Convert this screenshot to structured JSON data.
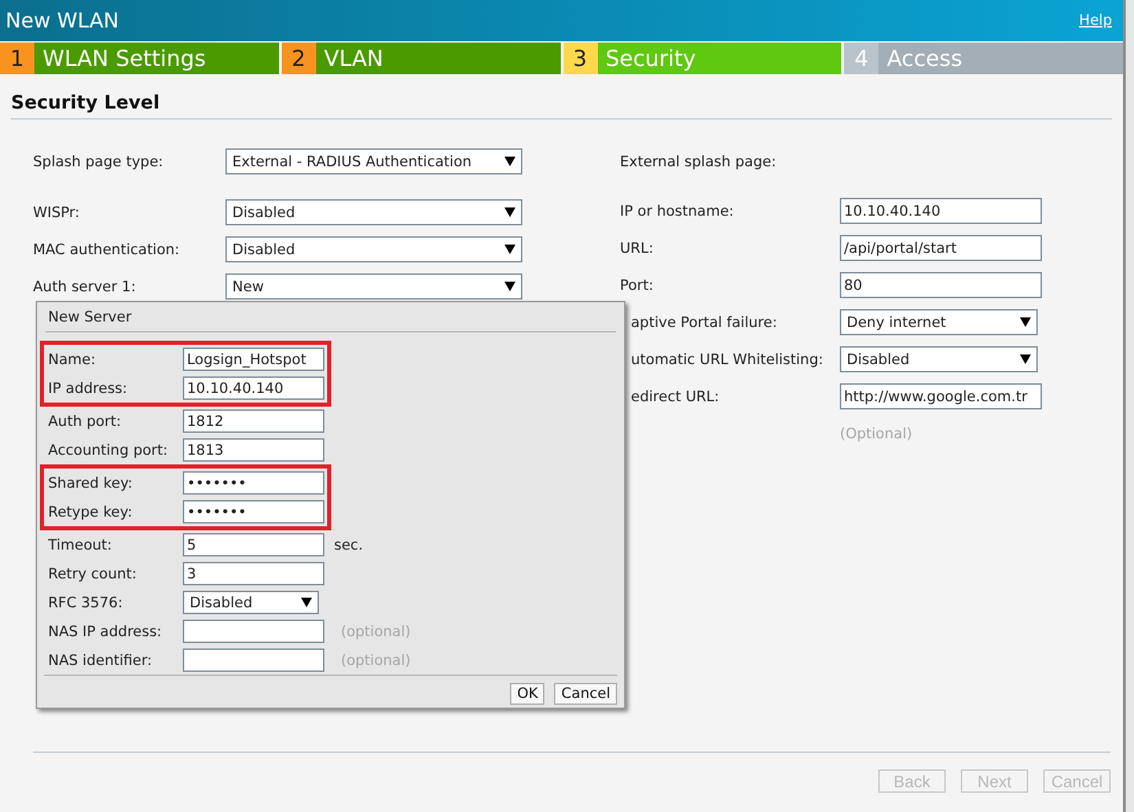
{
  "window": {
    "title": "New WLAN",
    "help_link": "Help"
  },
  "steps": [
    {
      "number": "1",
      "label": "WLAN Settings",
      "done": true,
      "selected": false
    },
    {
      "number": "2",
      "label": "VLAN",
      "done": true,
      "selected": false
    },
    {
      "number": "3",
      "label": "Security",
      "done": false,
      "selected": true
    },
    {
      "number": "4",
      "label": "Access",
      "done": false,
      "selected": false
    }
  ],
  "section_title": "Security Level",
  "left_fields": [
    {
      "label": "Splash page type:",
      "kind": "select",
      "value": "External - RADIUS Authentication"
    },
    {
      "label": "WISPr:",
      "kind": "select",
      "value": "Disabled"
    },
    {
      "label": "MAC authentication:",
      "kind": "select",
      "value": "Disabled"
    },
    {
      "label": "Auth server 1:",
      "kind": "select",
      "value": "New"
    }
  ],
  "right_fields": [
    {
      "label": "External splash page:",
      "kind": "heading"
    },
    {
      "label": "IP or hostname:",
      "kind": "text",
      "value": "10.10.40.140"
    },
    {
      "label": "URL:",
      "kind": "text",
      "value": "/api/portal/start"
    },
    {
      "label": "Port:",
      "kind": "text",
      "value": "80"
    },
    {
      "label": "aptive Portal failure:",
      "kind": "select",
      "value": "Deny internet",
      "partly_hidden": true
    },
    {
      "label": "utomatic URL Whitelisting:",
      "kind": "select",
      "value": "Disabled",
      "partly_hidden": true
    },
    {
      "label": "edirect URL:",
      "kind": "text",
      "value": "http://www.google.com.tr",
      "partly_hidden": true,
      "note": "(Optional)"
    }
  ],
  "dialog": {
    "title": "New Server",
    "field_groups": [
      {
        "highlighted": true,
        "fields": [
          {
            "label": "Name:",
            "kind": "text",
            "value": "Logsign_Hotspot"
          },
          {
            "label": "IP address:",
            "kind": "text",
            "value": "10.10.40.140"
          }
        ]
      },
      {
        "highlighted": false,
        "fields": [
          {
            "label": "Auth port:",
            "kind": "text",
            "value": "1812"
          },
          {
            "label": "Accounting port:",
            "kind": "text",
            "value": "1813"
          }
        ]
      },
      {
        "highlighted": true,
        "fields": [
          {
            "label": "Shared key:",
            "kind": "text",
            "value": "•••••••"
          },
          {
            "label": "Retype key:",
            "kind": "text",
            "value": "•••••••"
          }
        ]
      },
      {
        "highlighted": false,
        "fields": [
          {
            "label": "Timeout:",
            "kind": "text",
            "value": "5",
            "suffix": "sec."
          },
          {
            "label": "Retry count:",
            "kind": "text",
            "value": "3"
          },
          {
            "label": "RFC 3576:",
            "kind": "select",
            "value": "Disabled"
          },
          {
            "label": "NAS IP address:",
            "kind": "text",
            "suffix": "(optional)"
          },
          {
            "label": "NAS identifier:",
            "kind": "text",
            "suffix": "(optional)"
          }
        ]
      }
    ],
    "buttons": [
      "OK",
      "Cancel"
    ]
  },
  "footer_buttons": [
    {
      "label": "Back",
      "disabled": true
    },
    {
      "label": "Next",
      "disabled": true
    },
    {
      "label": "Cancel",
      "disabled": true
    }
  ]
}
